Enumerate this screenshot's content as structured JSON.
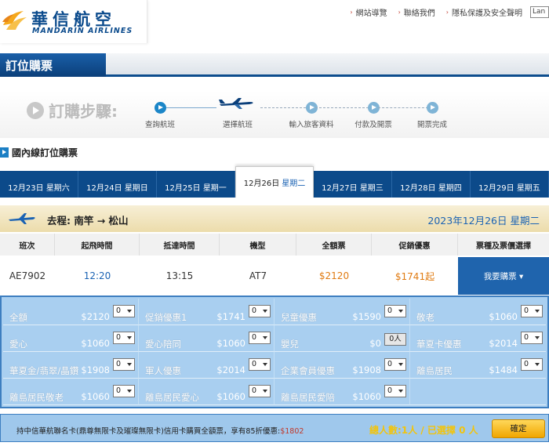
{
  "brand": {
    "name_cn": "華信航空",
    "name_en": "MANDARIN AIRLINES"
  },
  "top_links": [
    "網站導覽",
    "聯絡我們",
    "隱私保護及安全聲明"
  ],
  "language_select": "Lan",
  "page_title": "訂位購票",
  "steps": {
    "label": "訂購步驟:",
    "items": [
      "查詢航班",
      "選擇航班",
      "輸入旅客資料",
      "付款及開票",
      "開票完成"
    ],
    "current_index": 1
  },
  "section_heading": "國內線訂位購票",
  "date_tabs": [
    {
      "date": "12月23日",
      "weekday": "星期六"
    },
    {
      "date": "12月24日",
      "weekday": "星期日"
    },
    {
      "date": "12月25日",
      "weekday": "星期一"
    },
    {
      "date": "12月26日",
      "weekday": "星期二"
    },
    {
      "date": "12月27日",
      "weekday": "星期三"
    },
    {
      "date": "12月28日",
      "weekday": "星期四"
    },
    {
      "date": "12月29日",
      "weekday": "星期五"
    }
  ],
  "selected_date_index": 3,
  "route": {
    "text": "去程: 南竿 → 松山",
    "date": "2023年12月26日 星期二"
  },
  "table_headers": [
    "班次",
    "起飛時間",
    "抵達時間",
    "機型",
    "全額票",
    "促銷優惠",
    "票種及票價選擇"
  ],
  "flight": {
    "number": "AE7902",
    "departure": "12:20",
    "arrival": "13:15",
    "aircraft": "AT7",
    "full_fare": "$2120",
    "promo_fare": "$1741起",
    "buy_label": "我要購票 ▾"
  },
  "fares": [
    {
      "name": "全額",
      "price": "$2120",
      "qty": "0"
    },
    {
      "name": "促銷優惠1",
      "price": "$1741",
      "qty": "0"
    },
    {
      "name": "兒童優惠",
      "price": "$1590",
      "qty": "0"
    },
    {
      "name": "敬老",
      "price": "$1060",
      "qty": "0"
    },
    {
      "name": "愛心",
      "price": "$1060",
      "qty": "0"
    },
    {
      "name": "愛心陪同",
      "price": "$1060",
      "qty": "0"
    },
    {
      "name": "嬰兒",
      "price": "$0",
      "qty": "0人"
    },
    {
      "name": "華夏卡優惠",
      "price": "$2014",
      "qty": "0"
    },
    {
      "name": "華夏金/翡翠/晶鑽",
      "price": "$1908",
      "qty": "0"
    },
    {
      "name": "軍人優惠",
      "price": "$2014",
      "qty": "0"
    },
    {
      "name": "企業會員優惠",
      "price": "$1908",
      "qty": "0"
    },
    {
      "name": "離島居民",
      "price": "$1484",
      "qty": "0"
    },
    {
      "name": "離島居民敬老",
      "price": "$1060",
      "qty": "0"
    },
    {
      "name": "離島居民愛心",
      "price": "$1060",
      "qty": "0"
    },
    {
      "name": "離島居民愛陪",
      "price": "$1060",
      "qty": "0"
    }
  ],
  "footer": {
    "note_prefix": "持中信華航聯名卡(鼎尊無限卡及璀璨無限卡)信用卡購買全額票，享有85折優惠:",
    "note_amount": "$1802",
    "count_text": "總人數:1人 / 已選擇 0 人",
    "confirm_label": "確定"
  },
  "colors": {
    "brand_blue": "#0c4a8a",
    "accent_orange": "#e07b12",
    "link_blue": "#1a62b3",
    "panel_blue": "#a9cff0"
  }
}
